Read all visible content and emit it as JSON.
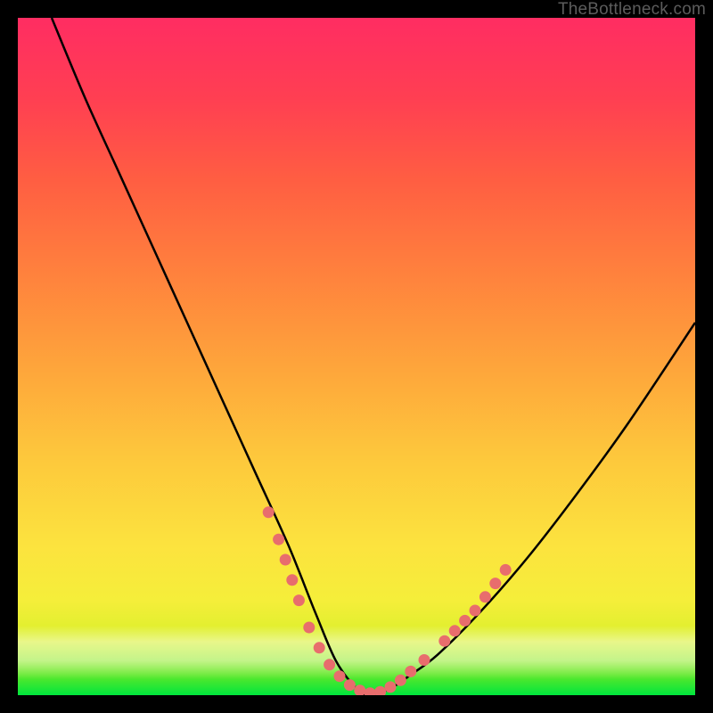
{
  "attribution": "TheBottleneck.com",
  "colors": {
    "frame": "#000000",
    "curve": "#000000",
    "dots": "#e86d6d",
    "gradient_top": "#ff2d62",
    "gradient_bottom": "#00e63d"
  },
  "chart_data": {
    "type": "line",
    "title": "",
    "xlabel": "",
    "ylabel": "",
    "xlim": [
      0,
      100
    ],
    "ylim": [
      0,
      100
    ],
    "grid": false,
    "legend": false,
    "annotations": [
      "TheBottleneck.com"
    ],
    "description": "V-shaped bottleneck curve on a red-to-green vertical gradient. Y roughly represents bottleneck percentage (red=high, green=low). Minimum near x≈52 where curve touches y≈0. Left arm rises steeply to 100 near x≈5; right arm rises more gently to about y≈55 at x=100. Salmon dots cluster along both lower arms near the trough.",
    "series": [
      {
        "name": "bottleneck-curve",
        "x": [
          5,
          10,
          15,
          20,
          25,
          30,
          35,
          40,
          44,
          47,
          50,
          52,
          55,
          58,
          62,
          68,
          75,
          82,
          90,
          100
        ],
        "y": [
          100,
          88,
          77,
          66,
          55,
          44,
          33,
          22,
          12,
          5,
          1,
          0,
          1,
          3,
          6,
          12,
          20,
          29,
          40,
          55
        ]
      }
    ],
    "dots": [
      {
        "x": 37,
        "y": 27
      },
      {
        "x": 38.5,
        "y": 23
      },
      {
        "x": 39.5,
        "y": 20
      },
      {
        "x": 40.5,
        "y": 17
      },
      {
        "x": 41.5,
        "y": 14
      },
      {
        "x": 43,
        "y": 10
      },
      {
        "x": 44.5,
        "y": 7
      },
      {
        "x": 46,
        "y": 4.5
      },
      {
        "x": 47.5,
        "y": 2.8
      },
      {
        "x": 49,
        "y": 1.5
      },
      {
        "x": 50.5,
        "y": 0.7
      },
      {
        "x": 52,
        "y": 0.3
      },
      {
        "x": 53.5,
        "y": 0.5
      },
      {
        "x": 55,
        "y": 1.2
      },
      {
        "x": 56.5,
        "y": 2.2
      },
      {
        "x": 58,
        "y": 3.5
      },
      {
        "x": 60,
        "y": 5.2
      },
      {
        "x": 63,
        "y": 8
      },
      {
        "x": 64.5,
        "y": 9.5
      },
      {
        "x": 66,
        "y": 11
      },
      {
        "x": 67.5,
        "y": 12.5
      },
      {
        "x": 69,
        "y": 14.5
      },
      {
        "x": 70.5,
        "y": 16.5
      },
      {
        "x": 72,
        "y": 18.5
      }
    ]
  }
}
